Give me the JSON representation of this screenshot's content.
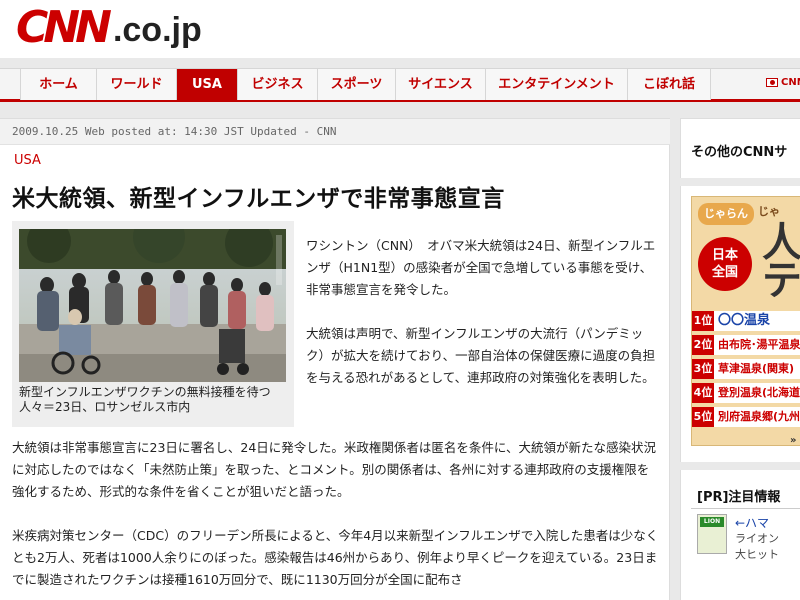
{
  "header": {
    "logo_cnn": "CNN",
    "logo_domain": ".co.jp"
  },
  "nav": {
    "items": [
      "ホーム",
      "ワールド",
      "USA",
      "ビジネス",
      "スポーツ",
      "サイエンス",
      "エンタテインメント",
      "こぼれ話"
    ],
    "active_index": 2,
    "lang_label": "CNN"
  },
  "article": {
    "meta": "2009.10.25 Web posted at:  14:30  JST Updated - CNN",
    "section": "USA",
    "headline": "米大統領、新型インフルエンザで非常事態宣言",
    "photo_caption": "新型インフルエンザワクチンの無料接種を待つ人々＝23日、ロサンゼルス市内",
    "paragraphs": [
      "ワシントン（CNN）　オバマ米大統領は24日、新型インフルエンザ（H1N1型）の感染者が全国で急増している事態を受け、非常事態宣言を発令した。",
      "大統領は声明で、新型インフルエンザの大流行（パンデミック）が拡大を続けており、一部自治体の保健医療に過度の負担を与える恐れがあるとして、連邦政府の対策強化を表明した。",
      "大統領は非常事態宣言に23日に署名し、24日に発令した。米政権関係者は匿名を条件に、大統領が新たな感染状況に対応したのではなく「未然防止策」を取った、とコメント。別の関係者は、各州に対する連邦政府の支援権限を強化するため、形式的な条件を省くことが狙いだと語った。",
      "米疾病対策センター（CDC）のフリーデン所長によると、今年4月以来新型インフルエンザで入院した患者は少なくとも2万人、死者は1000人余りにのぼった。感染報告は46州からあり、例年より早くピークを迎えている。23日までに製造されたワクチンは接種1610万回分で、既に1130万回分が全国に配布さ"
    ]
  },
  "sidebar": {
    "other_title": "その他のCNNサ",
    "onsen_ad": {
      "logo": "じゃらん",
      "top_text": "じゃ",
      "badge": "日本\n全国",
      "big_text_1": "人",
      "big_text_2": "テ",
      "ranks": [
        {
          "num": "1位",
          "name": "〇〇温泉"
        },
        {
          "num": "2位",
          "name": "由布院･湯平温泉"
        },
        {
          "num": "3位",
          "name": "草津温泉(関東)"
        },
        {
          "num": "4位",
          "name": "登別温泉(北海道"
        },
        {
          "num": "5位",
          "name": "別府温泉郷(九州"
        }
      ],
      "more": "»"
    },
    "pr": {
      "title": "[PR]注目情報",
      "img_label": "LION",
      "link": "←ハマ",
      "text1": "ライオン",
      "text2": "大ヒット"
    }
  }
}
